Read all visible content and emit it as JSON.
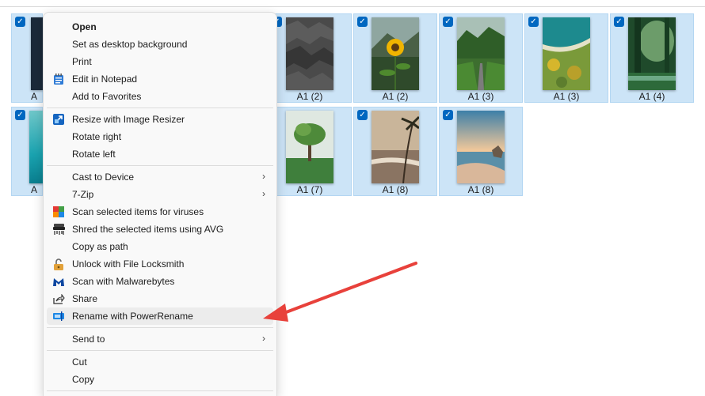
{
  "files": [
    {
      "caption": "A1 (2)"
    },
    {
      "caption": "A1 (2)"
    },
    {
      "caption": "A1 (3)"
    },
    {
      "caption": "A1 (3)"
    },
    {
      "caption": "A1 (4)"
    },
    {
      "caption": "A1 (7)"
    },
    {
      "caption": "A1 (8)"
    },
    {
      "caption": "A1 (8)"
    }
  ],
  "partial_captions": [
    "A",
    "A"
  ],
  "checkmark": "✓",
  "context_menu": {
    "items": [
      {
        "label": "Open",
        "icon": "none"
      },
      {
        "label": "Set as desktop background",
        "icon": "none"
      },
      {
        "label": "Print",
        "icon": "none"
      },
      {
        "label": "Edit in Notepad",
        "icon": "notepad-icon"
      },
      {
        "label": "Add to Favorites",
        "icon": "none"
      },
      {
        "label": "Resize with Image Resizer",
        "icon": "image-resizer-icon"
      },
      {
        "label": "Rotate right",
        "icon": "none"
      },
      {
        "label": "Rotate left",
        "icon": "none"
      },
      {
        "label": "Cast to Device",
        "icon": "none",
        "submenu": true
      },
      {
        "label": "7-Zip",
        "icon": "none",
        "submenu": true
      },
      {
        "label": "Scan selected items for viruses",
        "icon": "avg-icon"
      },
      {
        "label": "Shred the selected items using AVG",
        "icon": "shredder-icon"
      },
      {
        "label": "Copy as path",
        "icon": "none"
      },
      {
        "label": "Unlock with File Locksmith",
        "icon": "lock-icon"
      },
      {
        "label": "Scan with Malwarebytes",
        "icon": "malwarebytes-icon"
      },
      {
        "label": "Share",
        "icon": "share-icon"
      },
      {
        "label": "Rename with PowerRename",
        "icon": "powerrename-icon",
        "highlighted": true
      },
      {
        "label": "Send to",
        "icon": "none",
        "submenu": true
      },
      {
        "label": "Cut",
        "icon": "none"
      },
      {
        "label": "Copy",
        "icon": "none"
      }
    ],
    "submenu_glyph": "›"
  },
  "colors": {
    "selection": "#cce4f7",
    "checkbox": "#0067c0",
    "annotation_arrow": "#e8413b",
    "menu_bg": "#f9f9f9"
  }
}
